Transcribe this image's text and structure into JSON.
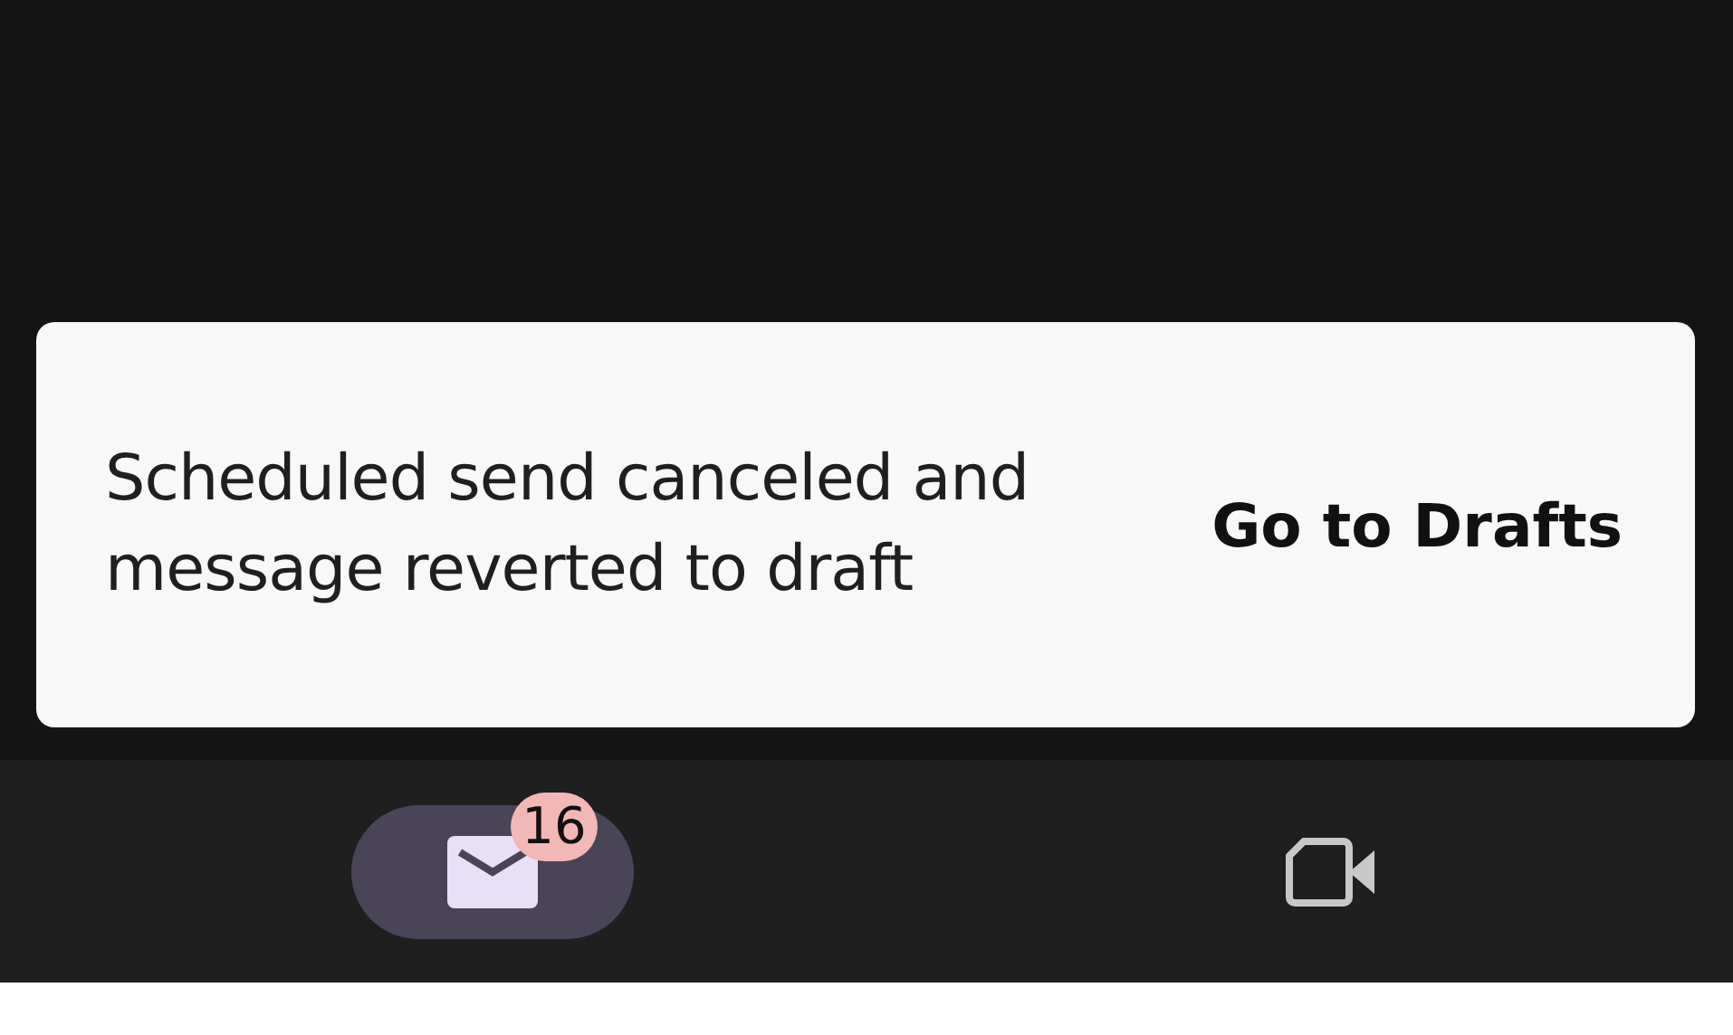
{
  "snackbar": {
    "message": "Scheduled send canceled and message reverted to draft",
    "action": "Go to Drafts"
  },
  "nav_items": [
    {
      "kind": "mail",
      "selected": true,
      "badge": "16"
    },
    {
      "kind": "video",
      "selected": false
    }
  ]
}
